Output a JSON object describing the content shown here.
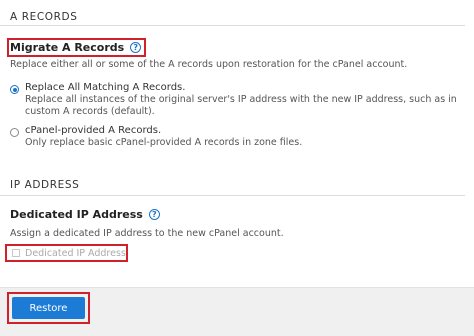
{
  "a_records": {
    "section_title": "A RECORDS",
    "migrate": {
      "title": "Migrate A Records",
      "help_icon": "question-circle-icon",
      "description": "Replace either all or some of the A records upon restoration for the cPanel account.",
      "options": [
        {
          "label": "Replace All Matching A Records.",
          "help": "Replace all instances of the original server's IP address with the new IP address, such as in custom A records (default).",
          "checked": true
        },
        {
          "label": "cPanel-provided A Records.",
          "help": "Only replace basic cPanel-provided A records in zone files.",
          "checked": false
        }
      ]
    }
  },
  "ip_address": {
    "section_title": "IP ADDRESS",
    "dedicated": {
      "title": "Dedicated IP Address",
      "help_icon": "question-circle-icon",
      "description": "Assign a dedicated IP address to the new cPanel account.",
      "checkbox_label": "Dedicated IP Address",
      "checked": false,
      "disabled": true
    }
  },
  "footer": {
    "restore_label": "Restore"
  },
  "colors": {
    "accent": "#1c7cd5",
    "highlight_outline": "#d0202a"
  }
}
